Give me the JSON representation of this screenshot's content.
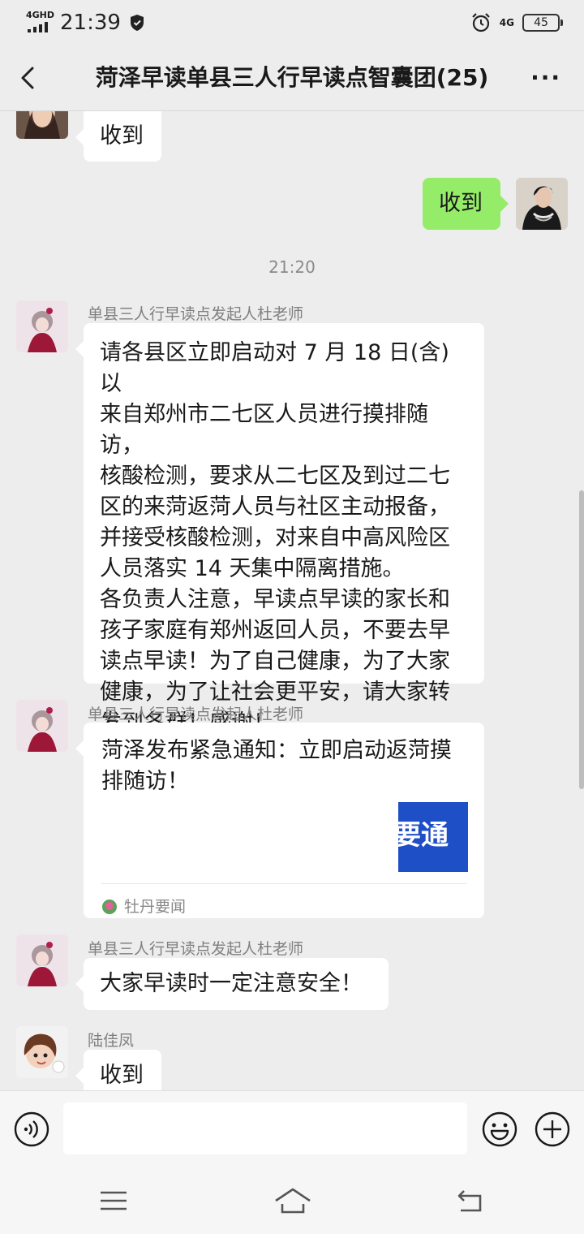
{
  "status_bar": {
    "network_label": "4GHD",
    "time": "21:39",
    "network_right": "4G",
    "battery": "45",
    "icons": [
      "signal-icon",
      "shield-icon",
      "alarm-icon",
      "battery-icon"
    ]
  },
  "header": {
    "title": "菏泽早读单县三人行早读点智囊团(25)",
    "more": "···",
    "icons": [
      "back-arrow-icon",
      "more-icon"
    ]
  },
  "messages": [
    {
      "type": "text",
      "side": "left",
      "text": "收到",
      "avatar": "woman-photo"
    },
    {
      "type": "text",
      "side": "right",
      "text": "收到",
      "avatar": "self-photo"
    },
    {
      "type": "time",
      "text": "21:20"
    },
    {
      "type": "text",
      "side": "left",
      "sender": "单县三人行早读点发起人杜老师",
      "lines": [
        "请各县区立即启动对 7 月 18 日(含)以",
        "来自郑州市二七区人员进行摸排随访，",
        "核酸检测，要求从二七区及到过二七",
        "区的来菏返菏人员与社区主动报备，",
        "并接受核酸检测，对来自中高风险区",
        "人员落实 14 天集中隔离措施。",
        "各负责人注意，早读点早读的家长和",
        "孩子家庭有郑州返回人员，不要去早",
        "读点早读！为了自己健康，为了大家",
        "健康，为了让社会更平安，请大家转",
        "发到各群！感谢！"
      ]
    },
    {
      "type": "card",
      "side": "left",
      "sender": "单县三人行早读点发起人杜老师",
      "title": "菏泽发布紧急通知：立即启动返菏摸排随访！",
      "thumbnail_text": "要通",
      "source": "牡丹要闻"
    },
    {
      "type": "text",
      "side": "left",
      "sender": "单县三人行早读点发起人杜老师",
      "text": "大家早读时一定注意安全！"
    },
    {
      "type": "text",
      "side": "left",
      "sender": "陆佳凤",
      "text": "收到"
    }
  ],
  "input_bar": {
    "message_value": "",
    "icons": [
      "voice-icon",
      "emoji-icon",
      "plus-icon"
    ]
  },
  "system_nav": {
    "icons": [
      "menu-icon",
      "home-icon",
      "back-icon"
    ]
  },
  "colors": {
    "background": "#ededed",
    "bubble_in": "#ffffff",
    "bubble_out": "#95ec69",
    "sender_text": "#808080",
    "thumb_blue": "#1f4fc6"
  }
}
